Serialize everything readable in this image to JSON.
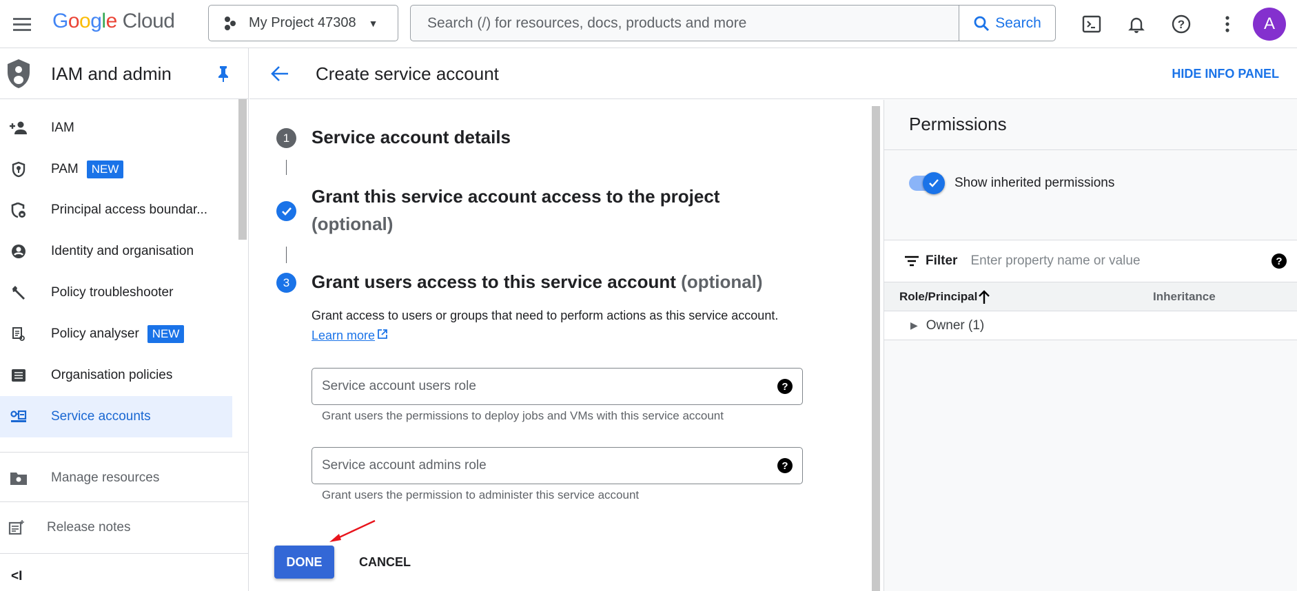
{
  "topbar": {
    "logo_google": "Google",
    "logo_cloud": "Cloud",
    "project": "My Project 47308",
    "search_placeholder": "Search (/) for resources, docs, products and more",
    "search_button": "Search",
    "avatar_initial": "A"
  },
  "sidebar": {
    "title": "IAM and admin",
    "items": [
      {
        "label": "IAM"
      },
      {
        "label": "PAM",
        "badge": "NEW"
      },
      {
        "label": "Principal access boundar..."
      },
      {
        "label": "Identity and organisation"
      },
      {
        "label": "Policy troubleshooter"
      },
      {
        "label": "Policy analyser",
        "badge": "NEW"
      },
      {
        "label": "Organisation policies"
      },
      {
        "label": "Service accounts"
      }
    ],
    "manage_resources": "Manage resources",
    "release_notes": "Release notes",
    "collapse": "<I"
  },
  "main": {
    "title": "Create service account",
    "hide_info_panel": "HIDE INFO PANEL",
    "steps": [
      {
        "number": "1",
        "title": "Service account details"
      },
      {
        "title": "Grant this service account access to the project",
        "optional": "(optional)"
      },
      {
        "number": "3",
        "title": "Grant users access to this service account",
        "optional": "(optional)"
      }
    ],
    "description": "Grant access to users or groups that need to perform actions as this service account.",
    "learn_more": "Learn more",
    "fields": [
      {
        "placeholder": "Service account users role",
        "hint": "Grant users the permissions to deploy jobs and VMs with this service account"
      },
      {
        "placeholder": "Service account admins role",
        "hint": "Grant users the permission to administer this service account"
      }
    ],
    "done": "DONE",
    "cancel": "CANCEL"
  },
  "panel": {
    "title": "Permissions",
    "toggle_label": "Show inherited permissions",
    "toggle_on": true,
    "filter_label": "Filter",
    "filter_placeholder": "Enter property name or value",
    "columns": [
      "Role/Principal",
      "Inheritance"
    ],
    "rows": [
      {
        "label": "Owner (1)"
      }
    ]
  },
  "colors": {
    "accent": "#1a73e8",
    "selected_bg": "#e8f0fe",
    "annotation_arrow": "#e8141c"
  }
}
